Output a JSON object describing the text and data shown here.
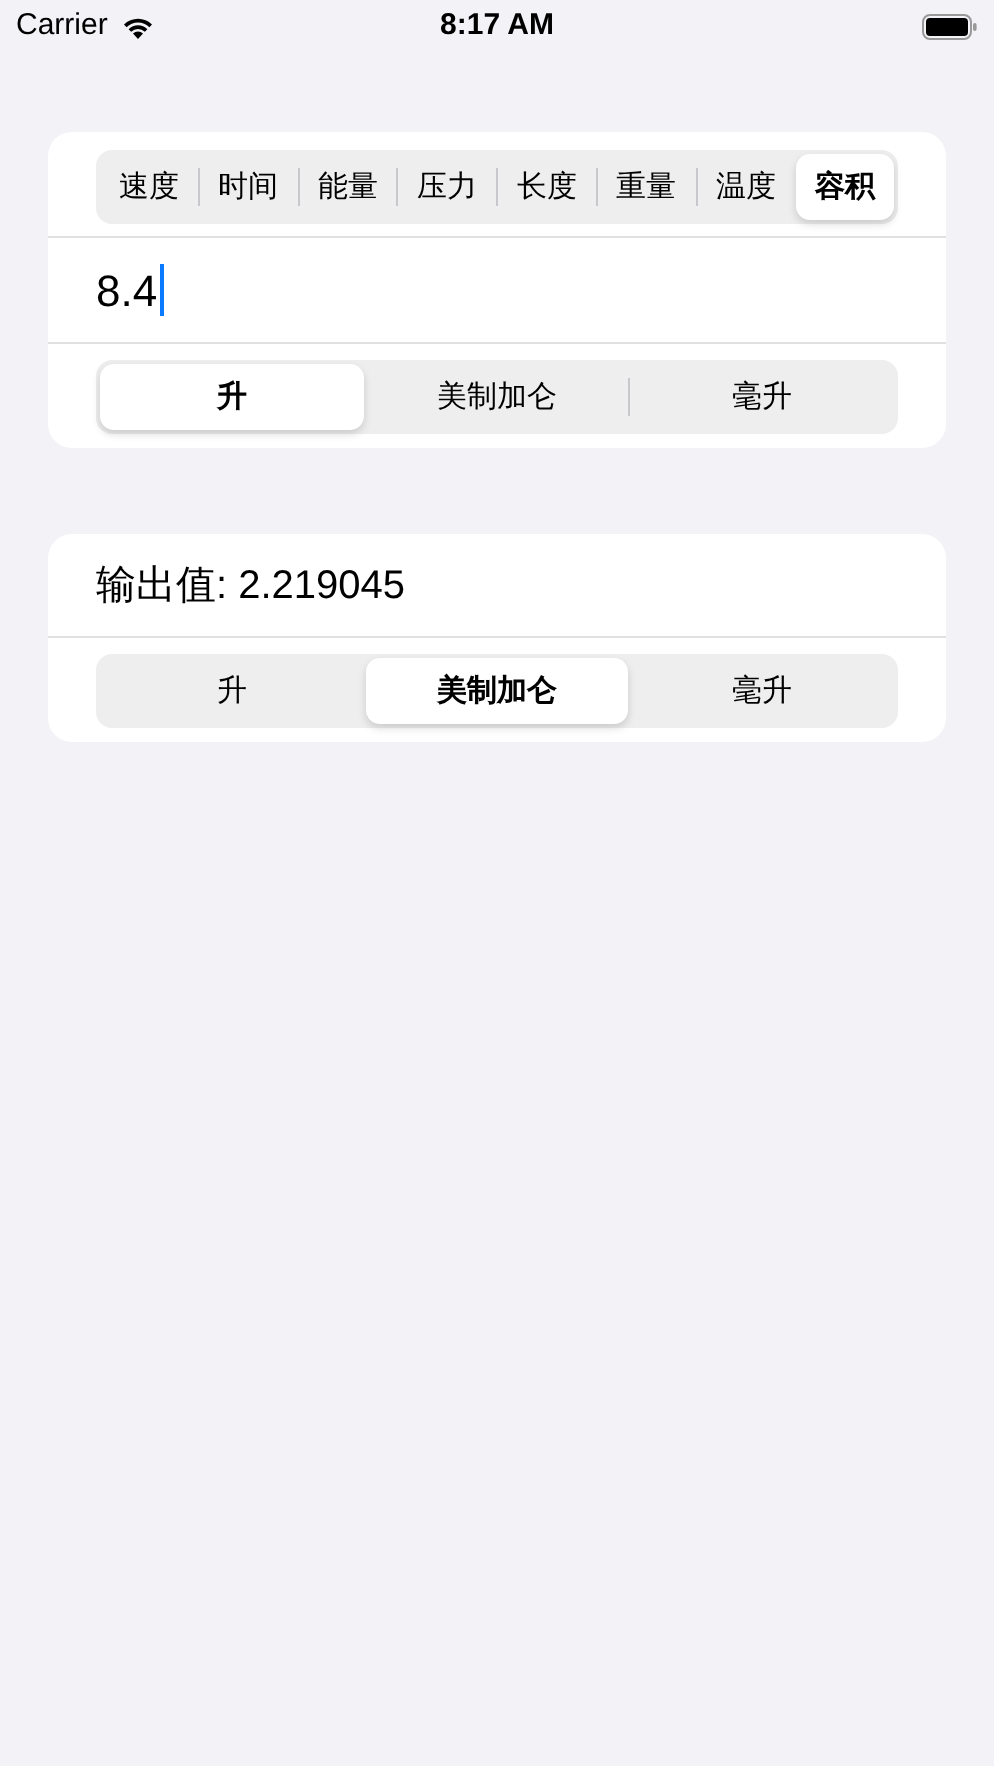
{
  "status_bar": {
    "carrier": "Carrier",
    "time": "8:17 AM"
  },
  "converter": {
    "categories": [
      {
        "label": "速度",
        "selected": false
      },
      {
        "label": "时间",
        "selected": false
      },
      {
        "label": "能量",
        "selected": false
      },
      {
        "label": "压力",
        "selected": false
      },
      {
        "label": "长度",
        "selected": false
      },
      {
        "label": "重量",
        "selected": false
      },
      {
        "label": "温度",
        "selected": false
      },
      {
        "label": "容积",
        "selected": true
      }
    ],
    "input": {
      "value": "8.4",
      "focused": true
    },
    "from_units": [
      {
        "label": "升",
        "selected": true
      },
      {
        "label": "美制加仑",
        "selected": false
      },
      {
        "label": "毫升",
        "selected": false
      }
    ]
  },
  "output": {
    "label": "输出值: 2.219045",
    "to_units": [
      {
        "label": "升",
        "selected": false
      },
      {
        "label": "美制加仑",
        "selected": true
      },
      {
        "label": "毫升",
        "selected": false
      }
    ]
  }
}
